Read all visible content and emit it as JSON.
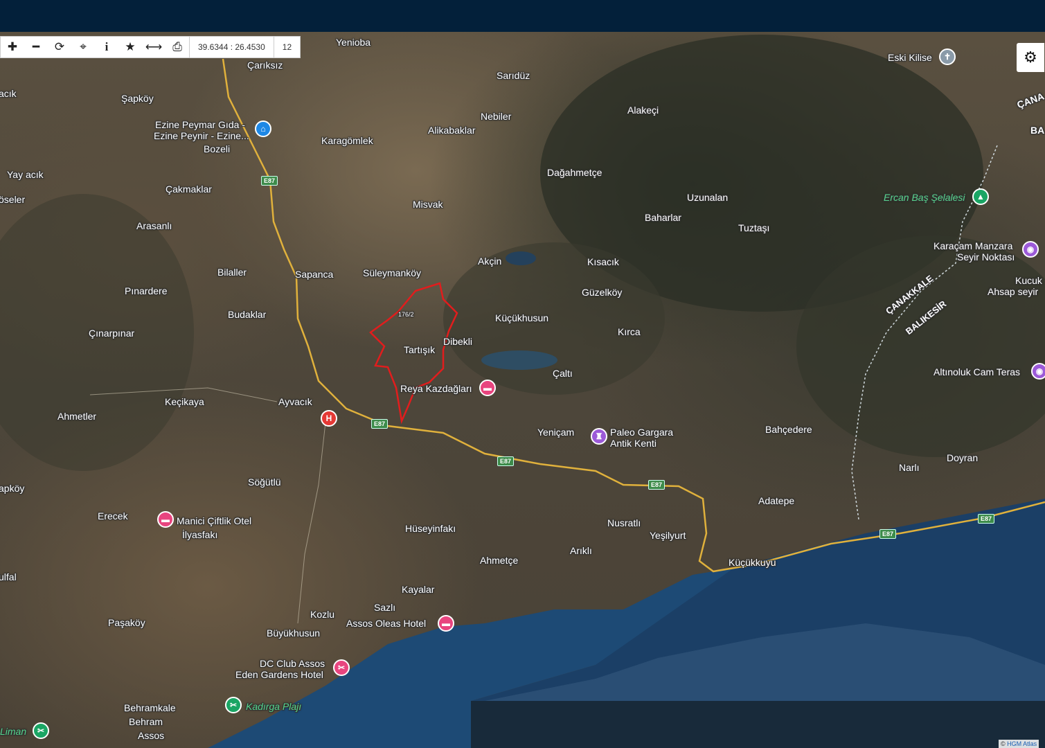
{
  "toolbar": {
    "coords": "39.6344 : 26.4530",
    "zoom": "12",
    "icons": [
      "zoom-in-icon",
      "zoom-out-icon",
      "refresh-icon",
      "locate-icon",
      "info-icon",
      "favorite-icon",
      "measure-icon",
      "print-icon"
    ]
  },
  "attribution": {
    "prefix": "© ",
    "brand": "HGM Atlas"
  },
  "parcel_label": "176/2",
  "places": {
    "yenioba": "Yenioba",
    "cariksiz": "Çarıksız",
    "saridüz": "Sarıdüz",
    "eski_kilise": "Eski Kilise",
    "sapkoy": "Şapköy",
    "nebiler": "Nebiler",
    "alakeci": "Alakeçi",
    "canak": "ÇANA",
    "ezine1": "Ezine Peymar Gıda -",
    "ezine2": "Ezine Peynir - Ezine...",
    "alikabaklar": "Alikabaklar",
    "karagomlek": "Karagömlek",
    "bozeli": "Bozeli",
    "yayacik": "Yay acık",
    "dagahmetce": "Dağahmetçe",
    "cakmaklar": "Çakmaklar",
    "oseler": "öseler",
    "uzunalan": "Uzunalan",
    "ercan": "Ercan Baş Şelalesi",
    "misvak": "Misvak",
    "baharlar": "Baharlar",
    "arasanli": "Arasanlı",
    "tuztasi": "Tuztaşı",
    "karacam1": "Karaçam Manzara",
    "karacam2": "Seyir Noktası",
    "akcin": "Akçin",
    "kisacik": "Kısacık",
    "bilaller": "Bilaller",
    "sapanca": "Sapanca",
    "suleymankoy": "Süleymanköy",
    "kucuk1": "Kucuk",
    "kucuk2": "Ahsap seyir",
    "pinardere": "Pınardere",
    "guzelkoy": "Güzelköy",
    "canakkale": "ÇANAKKALE",
    "balikesir": "BALIKESİR",
    "budaklar": "Budaklar",
    "kucukhusun": "Küçükhusun",
    "kirca": "Kırca",
    "cinarpinar": "Çınarpınar",
    "dibekli": "Dibekli",
    "tartisik": "Tartışık",
    "altinoluk": "Altınoluk Cam Teras",
    "calti": "Çaltı",
    "reya": "Reya Kazdağları",
    "kecikaya": "Keçikaya",
    "ayvacik": "Ayvacık",
    "ahmetler": "Ahmetler",
    "yenicam": "Yeniçam",
    "paleo1": "Paleo Gargara",
    "paleo2": "Antik Kenti",
    "bahcedere": "Bahçedere",
    "doyran": "Doyran",
    "narli": "Narlı",
    "sogutlu": "Söğütlü",
    "apkoy": "apköy",
    "adatepe": "Adatepe",
    "erecek": "Erecek",
    "manici": "Manici Çiftlik Otel",
    "ilyasfaki": "İlyasfakı",
    "nusratli": "Nusratlı",
    "huseyinfaki": "Hüseyinfakı",
    "yesilyurt": "Yeşilyurt",
    "arikli": "Arıklı",
    "ahmetce": "Ahmetçe",
    "kucukkuyu": "Küçükkuyu",
    "ulfal": "ulfal",
    "kayalar": "Kayalar",
    "sazli": "Sazlı",
    "kozlu": "Kozlu",
    "pasakoy": "Paşaköy",
    "assos_oleas": "Assos Oleas Hotel",
    "buyukhusun": "Büyükhusun",
    "dc1": "DC Club Assos",
    "dc2": "Eden Gardens Hotel",
    "kadirga": "Kadırga Plajı",
    "behramkale": "Behramkale",
    "behram": "Behram",
    "assos": "Assos",
    "liman": "Liman",
    "acik": "acık",
    "ba": "BA"
  },
  "roads": [
    "E87",
    "E87",
    "E87",
    "E87",
    "E87",
    "E87"
  ]
}
